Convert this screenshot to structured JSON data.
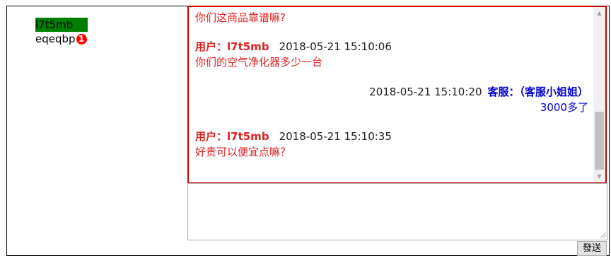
{
  "users": [
    {
      "name": "l7t5mb",
      "active": true
    },
    {
      "name": "eqeqbp",
      "badge": "1"
    }
  ],
  "messages": [
    {
      "text": "你们这商品靠谱嘛?"
    },
    {
      "sender": "用户：l7t5mb",
      "time": "2018-05-21 15:10:06",
      "text": "你们的空气净化器多少一台"
    },
    {
      "sender": "客服：（客服小姐姐）",
      "time": "2018-05-21 15:10:20",
      "text": "3000多了"
    },
    {
      "sender": "用户：l7t5mb",
      "time": "2018-05-21 15:10:35",
      "text": "好贵可以便宜点嘛？"
    }
  ],
  "input": {
    "value": ""
  },
  "send_label": "發送",
  "colors": {
    "user_msg": "#e02020",
    "service_msg": "#0000cc",
    "active_user_bg": "#008000",
    "badge": "#ff0000",
    "chat_border": "#cc0000"
  },
  "scrollbar": {
    "position_fraction": 0.85
  }
}
